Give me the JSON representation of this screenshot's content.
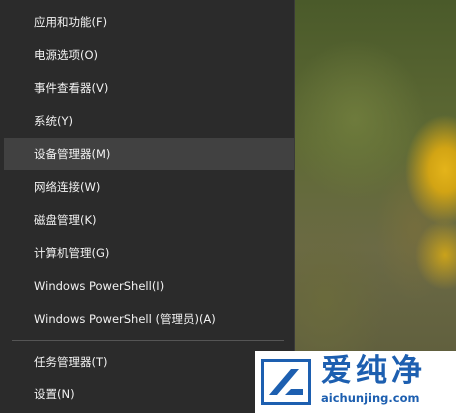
{
  "menu": {
    "items": [
      {
        "label": "应用和功能(F)"
      },
      {
        "label": "电源选项(O)"
      },
      {
        "label": "事件查看器(V)"
      },
      {
        "label": "系统(Y)"
      },
      {
        "label": "设备管理器(M)",
        "selected": true
      },
      {
        "label": "网络连接(W)"
      },
      {
        "label": "磁盘管理(K)"
      },
      {
        "label": "计算机管理(G)"
      },
      {
        "label": "Windows PowerShell(I)"
      },
      {
        "label": "Windows PowerShell (管理员)(A)"
      },
      {
        "label": "任务管理器(T)"
      },
      {
        "label": "设置(N)"
      }
    ]
  },
  "watermark": {
    "title": "爱纯净",
    "url": "aichunjing.com",
    "color": "#1d5fb0"
  },
  "colors": {
    "menu_bg": "#2b2b2b",
    "selected_bg": "#414141",
    "text": "#f2f2f2"
  }
}
